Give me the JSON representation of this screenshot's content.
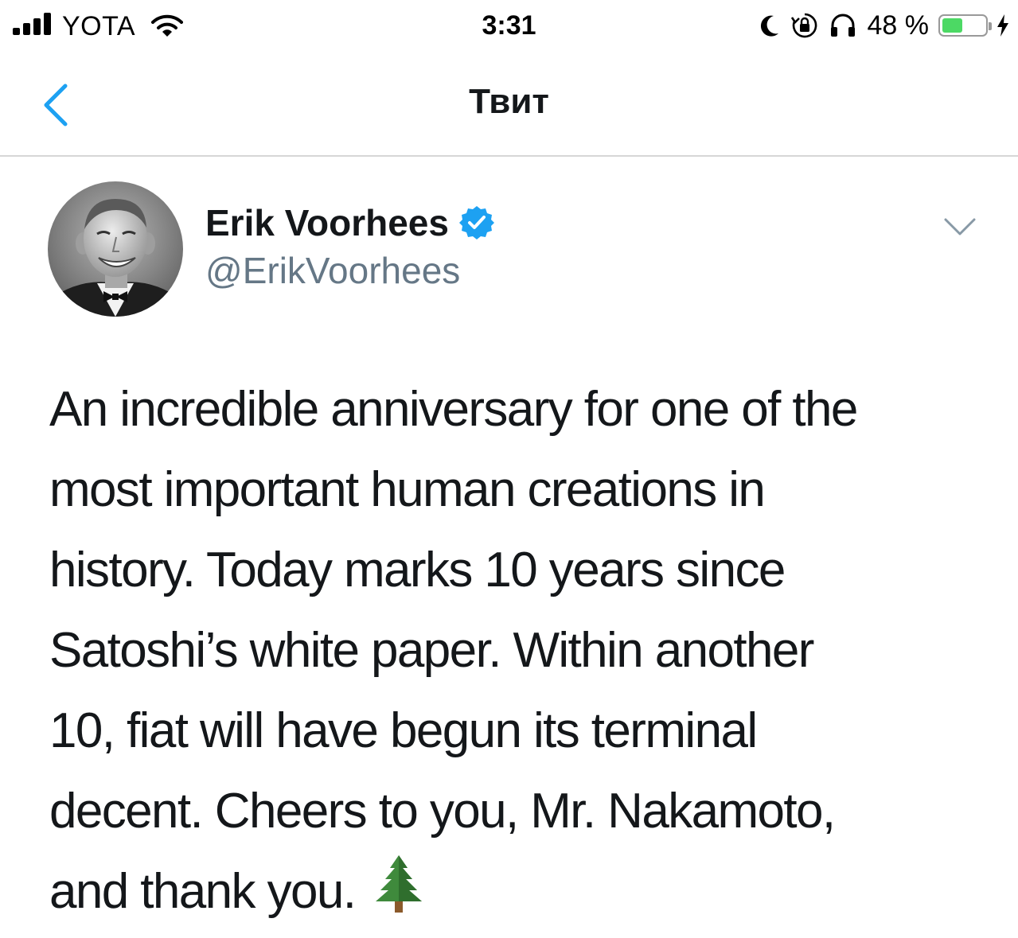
{
  "status_bar": {
    "carrier": "YOTA",
    "time": "3:31",
    "battery_text": "48 %",
    "battery_level": 0.48,
    "icons": [
      "signal-icon",
      "wifi-icon",
      "moon-icon",
      "rotation-lock-icon",
      "headphones-icon",
      "battery-icon",
      "charging-bolt-icon"
    ]
  },
  "nav": {
    "title": "Твит",
    "back_icon": "chevron-left-icon"
  },
  "tweet": {
    "author_name": "Erik Voorhees",
    "handle": "@ErikVoorhees",
    "verified": true,
    "lines": [
      "An incredible anniversary for one of the",
      "most important human creations in",
      "history. Today marks 10 years since",
      "Satoshi’s white paper. Within another",
      "10, fiat will have begun its terminal",
      "decent. Cheers to you, Mr. Nakamoto,",
      "and thank you."
    ],
    "emoji": "evergreen-tree-icon"
  },
  "colors": {
    "accent": "#1da1f2",
    "text": "#14171a",
    "secondary_text": "#657786",
    "divider": "#d6d6d6",
    "battery_green": "#4cd964"
  }
}
